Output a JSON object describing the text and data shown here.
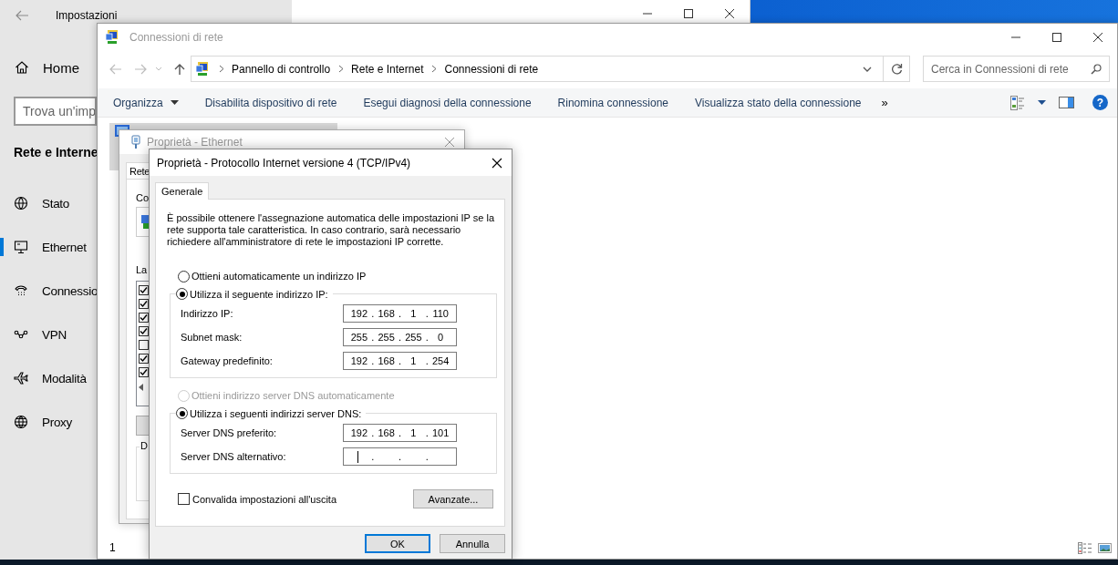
{
  "settings_window": {
    "title": "Impostazioni",
    "home": "Home",
    "search": {
      "placeholder": "Trova un'imp"
    },
    "section_title": "Rete e Interne",
    "items": [
      {
        "label": "Stato",
        "selected": false
      },
      {
        "label": "Ethernet",
        "selected": true
      },
      {
        "label": "Connessio",
        "selected": false
      },
      {
        "label": "VPN",
        "selected": false
      },
      {
        "label": "Modalità",
        "selected": false
      },
      {
        "label": "Proxy",
        "selected": false
      }
    ]
  },
  "explorer_window": {
    "title": "Connessioni di rete",
    "breadcrumb": [
      "Pannello di controllo",
      "Rete e Internet",
      "Connessioni di rete"
    ],
    "search": {
      "placeholder": "Cerca in Connessioni di rete"
    },
    "toolbar": [
      {
        "label": "Organizza",
        "dropdown": true
      },
      {
        "label": "Disabilita dispositivo di rete",
        "dropdown": false
      },
      {
        "label": "Esegui diagnosi della connessione",
        "dropdown": false
      },
      {
        "label": "Rinomina connessione",
        "dropdown": false
      },
      {
        "label": "Visualizza stato della connessione",
        "dropdown": false
      }
    ],
    "overflow": "»",
    "help": "?",
    "status_bar": "1"
  },
  "ethernet_dialog": {
    "title": "Proprietà - Ethernet",
    "tab": "Rete",
    "connect_label": "Co",
    "list_label": "La",
    "group_label": "D",
    "components": [
      {
        "checked": true
      },
      {
        "checked": true
      },
      {
        "checked": true
      },
      {
        "checked": true
      },
      {
        "checked": false
      },
      {
        "checked": true
      },
      {
        "checked": true
      }
    ]
  },
  "ipv4_dialog": {
    "title": "Proprietà - Protocollo Internet versione 4 (TCP/IPv4)",
    "tabs": [
      {
        "label": "Generale",
        "selected": true
      }
    ],
    "description": "È possibile ottenere l'assegnazione automatica delle impostazioni IP se la rete supporta tale caratteristica. In caso contrario, sarà necessario richiedere all'amministratore di rete le impostazioni IP corrette.",
    "ip_mode": [
      {
        "label": "Ottieni automaticamente un indirizzo IP",
        "selected": false,
        "disabled": false
      },
      {
        "label": "Utilizza il seguente indirizzo IP:",
        "selected": true,
        "disabled": false
      }
    ],
    "ip_fields": [
      {
        "label": "Indirizzo IP:",
        "octets": [
          "192",
          "168",
          "1",
          "110"
        ],
        "separators": [
          ".",
          ".",
          "."
        ],
        "focused": false
      },
      {
        "label": "Subnet mask:",
        "octets": [
          "255",
          "255",
          "255",
          "0"
        ],
        "separators": [
          ".",
          ".",
          "."
        ],
        "focused": false
      },
      {
        "label": "Gateway predefinito:",
        "octets": [
          "192",
          "168",
          "1",
          "254"
        ],
        "separators": [
          ".",
          ".",
          "."
        ],
        "focused": false
      }
    ],
    "dns_mode": [
      {
        "label": "Ottieni indirizzo server DNS automaticamente",
        "selected": false,
        "disabled": true
      },
      {
        "label": "Utilizza i seguenti indirizzi server DNS:",
        "selected": true,
        "disabled": false
      }
    ],
    "dns_fields": [
      {
        "label": "Server DNS preferito:",
        "octets": [
          "192",
          "168",
          "1",
          "101"
        ],
        "separators": [
          ".",
          ".",
          "."
        ],
        "focused": false
      },
      {
        "label": "Server DNS alternativo:",
        "separators": [
          ".",
          ".",
          "."
        ],
        "focused": true
      }
    ],
    "validate": {
      "label": "Convalida impostazioni all'uscita",
      "checked": false
    },
    "advanced_button": "Avanzate...",
    "buttons": [
      {
        "label": "OK",
        "default": true
      },
      {
        "label": "Annulla",
        "default": false
      }
    ]
  }
}
